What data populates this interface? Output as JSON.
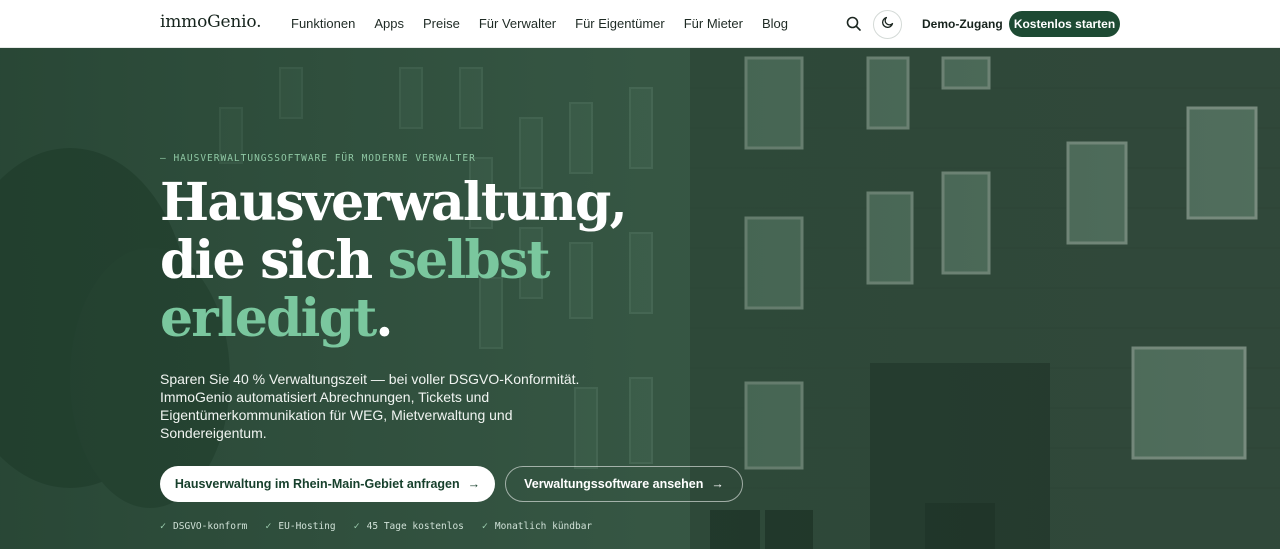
{
  "brand": {
    "logo_text": "immoGenio."
  },
  "nav": {
    "links": [
      "Funktionen",
      "Apps",
      "Preise",
      "Für Verwalter",
      "Für Eigentümer",
      "Für Mieter",
      "Blog"
    ],
    "search_icon": "search-icon",
    "theme_icon": "moon-icon",
    "demo_label": "Demo-Zugang",
    "cta_label": "Kostenlos starten"
  },
  "hero": {
    "eyebrow": "— HAUSVERWALTUNGSSOFTWARE FÜR MODERNE VERWALTER",
    "headline_line1": "Hausverwaltung,",
    "headline_line2_plain": "die sich ",
    "headline_line2_accent": "selbst",
    "headline_line3_accent": "erledigt",
    "headline_line3_end": ".",
    "subtext": "Sparen Sie 40 % Verwaltungszeit — bei voller DSGVO-Konformität. ImmoGenio automatisiert Abrechnungen, Tickets und Eigentümerkommunikation für WEG, Mietverwaltung und Sondereigentum.",
    "primary_button": "Hausverwaltung im Rhein-Main-Gebiet anfragen",
    "secondary_button": "Verwaltungssoftware ansehen",
    "arrow": "→",
    "checkmark": "✓",
    "features": [
      "DSGVO-konform",
      "EU-Hosting",
      "45 Tage kostenlos",
      "Monatlich kündbar"
    ]
  },
  "colors": {
    "brand_dark_green": "#1d4a33",
    "accent_green": "#7ac79e",
    "hero_overlay": "#2e4d3b"
  }
}
